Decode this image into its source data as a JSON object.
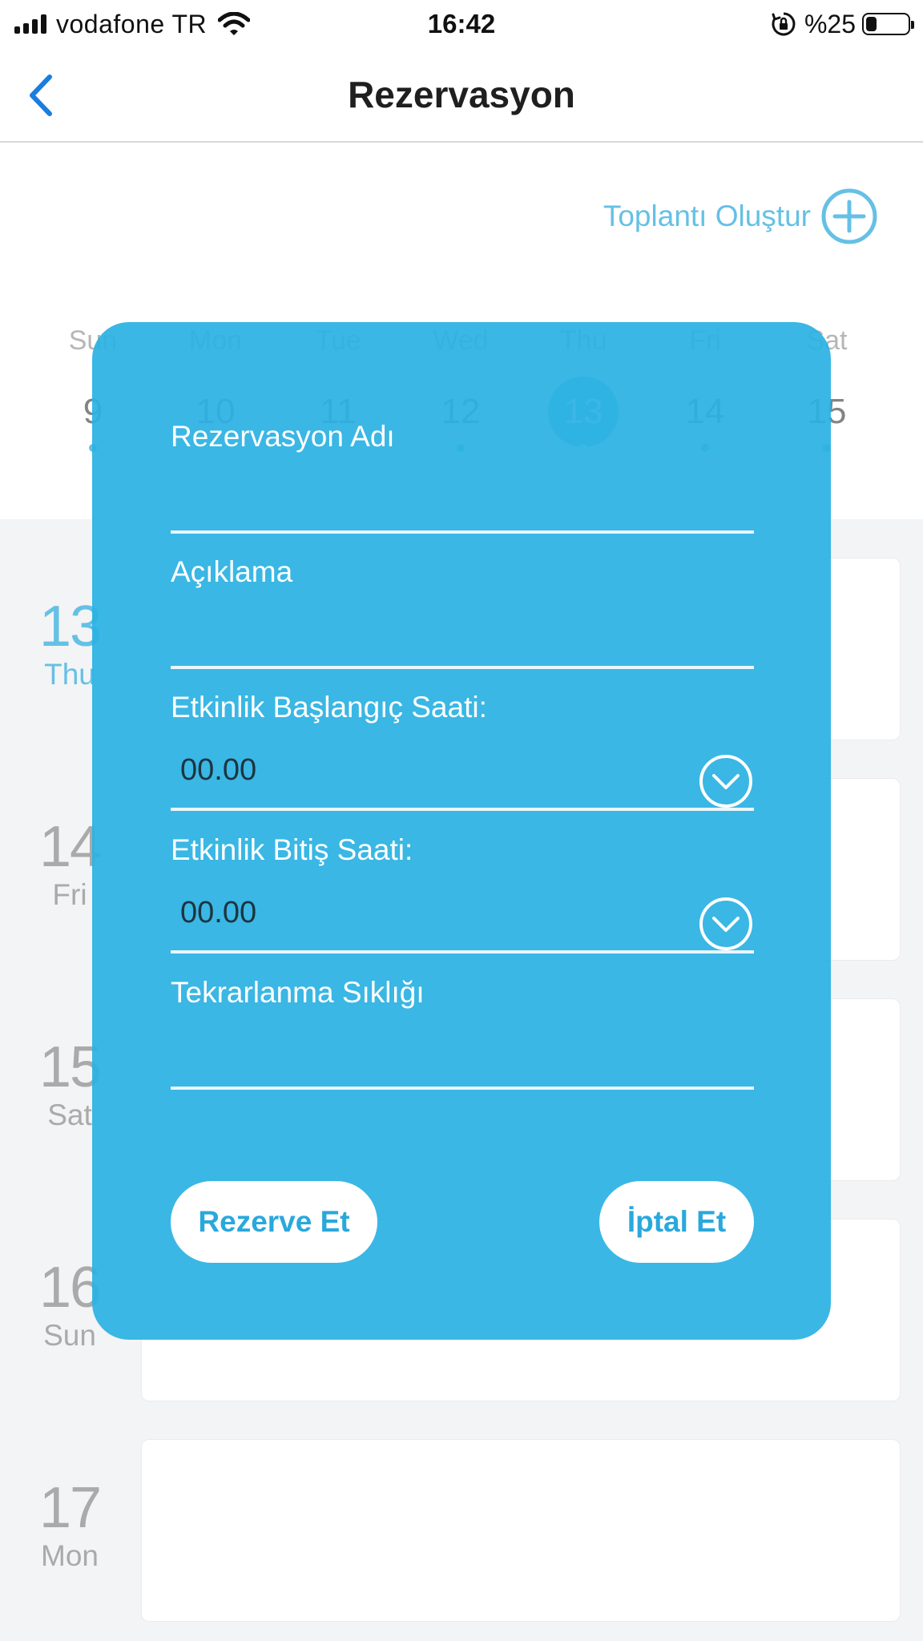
{
  "status_bar": {
    "carrier": "vodafone TR",
    "time": "16:42",
    "battery": "%25",
    "battery_level": 0.25
  },
  "nav": {
    "back_icon": "chevron-left-icon",
    "title": "Rezervasyon"
  },
  "create_meeting": {
    "label": "Toplantı Oluştur",
    "icon": "plus-circle-icon"
  },
  "week": {
    "days": [
      {
        "name": "Sun",
        "num": "9",
        "dot": true,
        "selected": false
      },
      {
        "name": "Mon",
        "num": "10",
        "dot": false,
        "selected": false
      },
      {
        "name": "Tue",
        "num": "11",
        "dot": false,
        "selected": false
      },
      {
        "name": "Wed",
        "num": "12",
        "dot": true,
        "selected": false
      },
      {
        "name": "Thu",
        "num": "13",
        "dot": true,
        "selected": true
      },
      {
        "name": "Fri",
        "num": "14",
        "dot": true,
        "selected": false
      },
      {
        "name": "Sat",
        "num": "15",
        "dot": true,
        "selected": false
      }
    ]
  },
  "agenda": [
    {
      "num": "13",
      "weekday": "Thu",
      "today": true
    },
    {
      "num": "14",
      "weekday": "Fri",
      "today": false
    },
    {
      "num": "15",
      "weekday": "Sat",
      "today": false
    },
    {
      "num": "16",
      "weekday": "Sun",
      "today": false
    },
    {
      "num": "17",
      "weekday": "Mon",
      "today": false
    }
  ],
  "modal": {
    "name_label": "Rezervasyon Adı",
    "name_value": "",
    "description_label": "Açıklama",
    "description_value": "",
    "start_label": "Etkinlik Başlangıç Saati:",
    "start_value": "00.00",
    "end_label": "Etkinlik Bitiş Saati:",
    "end_value": "00.00",
    "repeat_label": "Tekrarlanma Sıklığı",
    "repeat_value": "",
    "reserve_button": "Rezerve Et",
    "cancel_button": "İptal Et"
  },
  "colors": {
    "accent": "#2aa8dc",
    "modal_bg": "#36b7e5",
    "agenda_bg": "#eff0f2"
  }
}
